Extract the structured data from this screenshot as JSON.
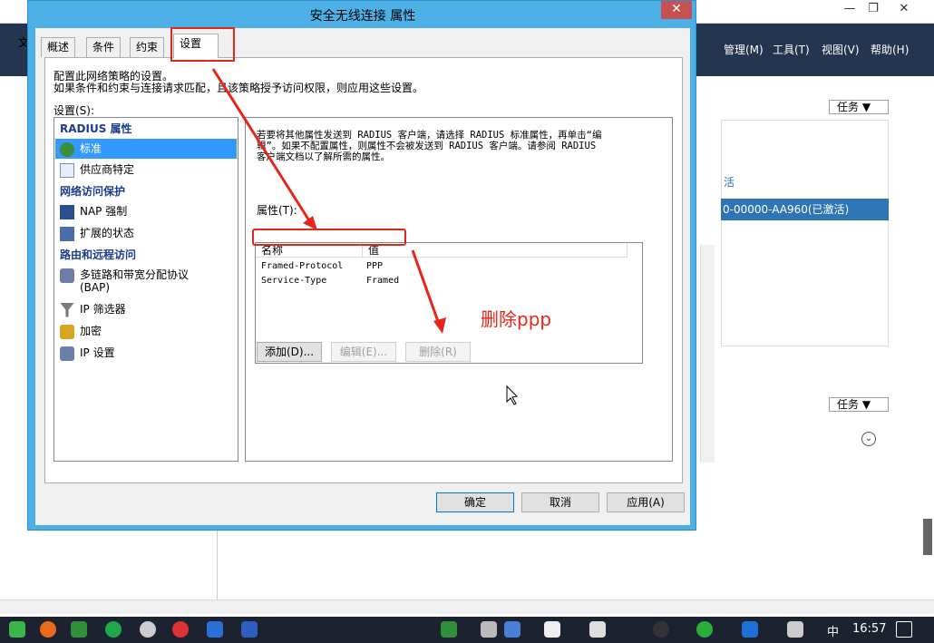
{
  "background_window": {
    "menu": [
      "管理(M)",
      "工具(T)",
      "视图(V)",
      "帮助(H)"
    ],
    "left_letter": "文",
    "task_button": "任务",
    "selected_row": "0-00000-AA960(已激活)",
    "partial_text": "活"
  },
  "dialog": {
    "title": "安全无线连接 属性",
    "close_label": "✕",
    "tabs": [
      "概述",
      "条件",
      "约束",
      "设置"
    ],
    "intro_line1": "配置此网络策略的设置。",
    "intro_line2": "如果条件和约束与连接请求匹配，且该策略授予访问权限，则应用这些设置。",
    "settings_label": "设置(S):",
    "settings_tree": {
      "cat1": "RADIUS 属性",
      "item_standard": "标准",
      "item_vendor": "供应商特定",
      "cat2": "网络访问保护",
      "item_nap": "NAP 强制",
      "item_ext": "扩展的状态",
      "cat3": "路由和远程访问",
      "item_bap": "多链路和带宽分配协议",
      "item_bap2": "(BAP)",
      "item_ipfilter": "IP 筛选器",
      "item_encrypt": "加密",
      "item_ipsettings": "IP 设置"
    },
    "description_l1": "若要将其他属性发送到 RADIUS 客户端，请选择 RADIUS 标准属性，再单击“编",
    "description_l2": "辑”。如果不配置属性，则属性不会被发送到 RADIUS 客户端。请参阅 RADIUS",
    "description_l3": "客户端文档以了解所需的属性。",
    "attributes_label": "属性(T):",
    "columns": [
      "名称",
      "值"
    ],
    "rows": [
      {
        "name": "Framed-Protocol",
        "value": "PPP"
      },
      {
        "name": "Service-Type",
        "value": "Framed"
      }
    ],
    "add_button": "添加(D)...",
    "edit_button": "编辑(E)...",
    "remove_button": "删除(R)",
    "ok_button": "确定",
    "cancel_button": "取消",
    "apply_button": "应用(A)"
  },
  "annotation": {
    "text": "删除ppp",
    "color": "#e8251a"
  },
  "taskbar": {
    "ime": "中",
    "time": "16:57"
  }
}
